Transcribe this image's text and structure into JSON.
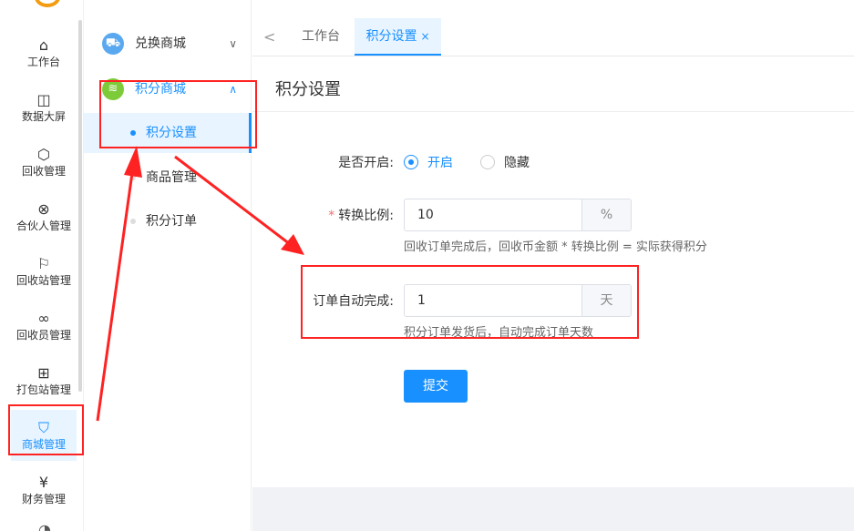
{
  "rail": {
    "items": [
      {
        "label": "工作台",
        "icon": "home-icon",
        "glyph": "⌂"
      },
      {
        "label": "数据大屏",
        "icon": "presentation-icon",
        "glyph": "◫"
      },
      {
        "label": "回收管理",
        "icon": "box-icon",
        "glyph": "⬡"
      },
      {
        "label": "合伙人管理",
        "icon": "link-icon",
        "glyph": "⊗"
      },
      {
        "label": "回收站管理",
        "icon": "flag-icon",
        "glyph": "⚐"
      },
      {
        "label": "回收员管理",
        "icon": "infinity-icon",
        "glyph": "∞"
      },
      {
        "label": "打包站管理",
        "icon": "package-icon",
        "glyph": "⊞"
      },
      {
        "label": "商城管理",
        "icon": "shopping-bag-icon",
        "glyph": "⛉"
      },
      {
        "label": "财务管理",
        "icon": "yen-icon",
        "glyph": "¥"
      }
    ],
    "partial_icon": "user-icon"
  },
  "submenu": {
    "groups": [
      {
        "title": "兑换商城",
        "icon": "cart-icon",
        "glyph": "🛒",
        "color": "#5aa9f0"
      },
      {
        "title": "积分商城",
        "icon": "layers-icon",
        "glyph": "≋",
        "color": "#7ecb3a"
      }
    ],
    "items": [
      "积分设置",
      "商品管理",
      "积分订单"
    ]
  },
  "tabs": {
    "items": [
      "工作台",
      "积分设置"
    ],
    "back_glyph": "<",
    "close_glyph": "×"
  },
  "page": {
    "title": "积分设置"
  },
  "form": {
    "enable_label": "是否开启:",
    "enable_options": [
      "开启",
      "隐藏"
    ],
    "ratio_label": "转换比例:",
    "ratio_value": "10",
    "ratio_unit": "%",
    "ratio_hint": "回收订单完成后，回收币金额 * 转换比例 = 实际获得积分",
    "auto_label": "订单自动完成:",
    "auto_value": "1",
    "auto_unit": "天",
    "auto_hint": "积分订单发货后，自动完成订单天数",
    "submit_label": "提交"
  },
  "colors": {
    "accent": "#1890ff",
    "annotation": "#ff2222",
    "required": "#f56c6c"
  }
}
